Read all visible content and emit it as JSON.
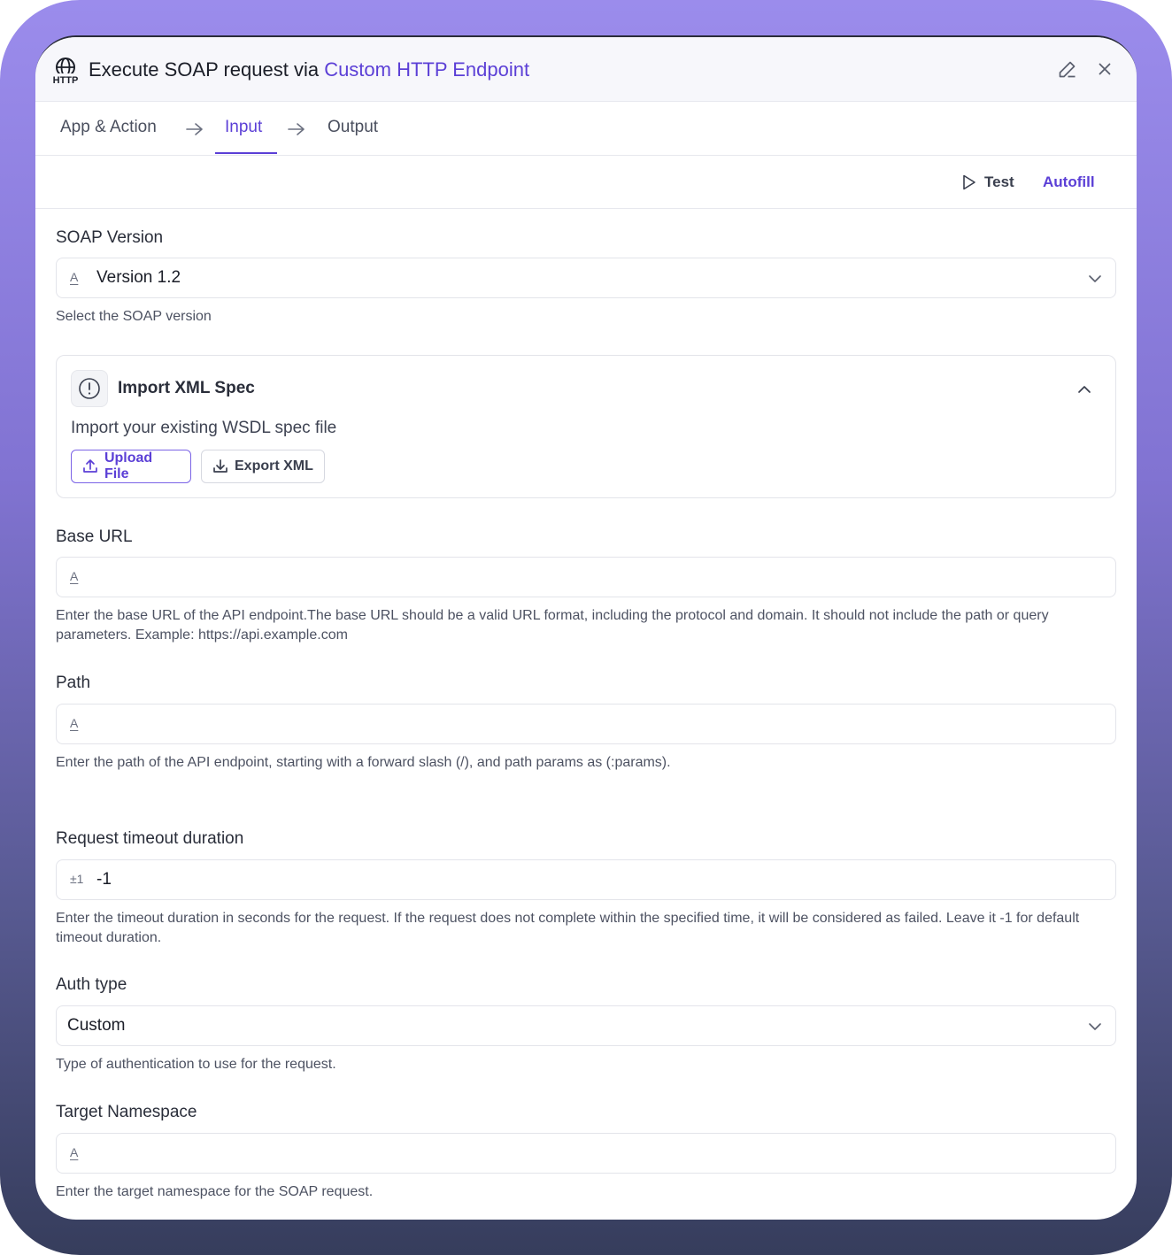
{
  "header": {
    "logo_text": "HTTP",
    "title_prefix": "Execute SOAP request via ",
    "title_accent": "Custom HTTP Endpoint"
  },
  "tabs": [
    {
      "label": "App & Action"
    },
    {
      "label": "Input"
    },
    {
      "label": "Output"
    }
  ],
  "toolbar": {
    "test_label": "Test",
    "autofill_label": "Autofill"
  },
  "soap_version": {
    "label": "SOAP Version",
    "prefix": "A",
    "value": "Version 1.2",
    "help": "Select the SOAP version"
  },
  "import_spec": {
    "title": "Import XML Spec",
    "description": "Import your existing WSDL spec file",
    "upload_label": "Upload File",
    "export_label": "Export XML"
  },
  "base_url": {
    "label": "Base URL",
    "prefix": "A",
    "value": "",
    "help": "Enter the base URL of the API endpoint.The base URL should be a valid URL format, including the protocol and domain. It should not include the path or query parameters. Example: https://api.example.com"
  },
  "path": {
    "label": "Path",
    "prefix": "A",
    "value": "",
    "help": "Enter the path of the API endpoint, starting with a forward slash (/), and path params as (:params)."
  },
  "timeout": {
    "label": "Request timeout duration",
    "prefix": "±1",
    "value": "-1",
    "help": "Enter the timeout duration in seconds for the request. If the request does not complete within the specified time, it will be considered as failed. Leave it -1 for default timeout duration."
  },
  "auth_type": {
    "label": "Auth type",
    "value": "Custom",
    "help": "Type of authentication to use for the request."
  },
  "target_namespace": {
    "label": "Target Namespace",
    "prefix": "A",
    "value": "",
    "help": "Enter the target namespace for the SOAP request."
  },
  "colors": {
    "accent": "#5b3fd6",
    "frame_top": "#9b8cec",
    "frame_bottom": "#363d5c"
  }
}
